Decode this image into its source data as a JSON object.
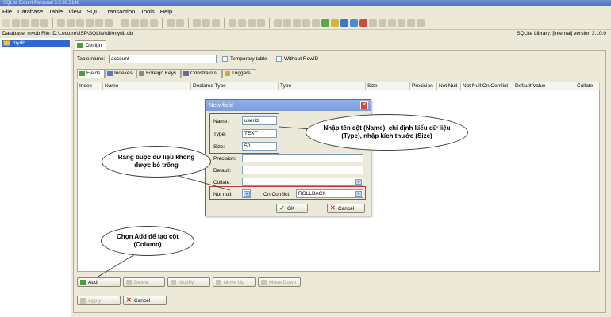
{
  "window": {
    "title": "SQLite Expert Personal 3.5.96.5148"
  },
  "menu": [
    "File",
    "Database",
    "Table",
    "View",
    "SQL",
    "Transaction",
    "Tools",
    "Help"
  ],
  "path_bar": {
    "left": "Database: mydb   File: D:\\Lecture\\JSP\\SQLite\\db\\mydb.db",
    "right": "SQLite Library: [internal] version 3.10.0"
  },
  "tree": {
    "root": "mydb"
  },
  "design_tab": "Design",
  "table_form": {
    "name_label": "Table name:",
    "name_value": "account",
    "temporary_label": "Temporary table",
    "without_rowid_label": "Without RowID"
  },
  "subtabs": [
    "Fields",
    "Indexes",
    "Foreign Keys",
    "Constraints",
    "Triggers"
  ],
  "grid_columns": [
    "Index",
    "Name",
    "Declared Type",
    "Type",
    "Size",
    "Precision",
    "Not Null",
    "Not Null On Conflict",
    "Default Value",
    "Collate"
  ],
  "field_buttons": {
    "add": "Add",
    "delete": "Delete",
    "modify": "Modify",
    "move_up": "Move Up",
    "move_down": "Move Down"
  },
  "bottom_buttons": {
    "apply": "Apply",
    "cancel": "Cancel"
  },
  "dialog": {
    "title": "New field",
    "name_label": "Name:",
    "name_value": "userid",
    "type_label": "Type:",
    "type_value": "TEXT",
    "size_label": "Size:",
    "size_value": "50",
    "precision_label": "Precision:",
    "default_label": "Default:",
    "collate_label": "Collate:",
    "notnull_label": "Not null:",
    "onconflict_label": "On Conflict:",
    "onconflict_value": "ROLLBACK",
    "ok_label": "OK",
    "cancel_label": "Cancel"
  },
  "callouts": {
    "name_type_size": "Nhập tên cột (Name), chỉ định kiểu dữ liệu (Type), nhập kích thước (Size)",
    "not_null": "Ràng buộc dữ liệu không được bỏ trống",
    "add_column": "Chọn Add để tạo cột (Column)"
  }
}
